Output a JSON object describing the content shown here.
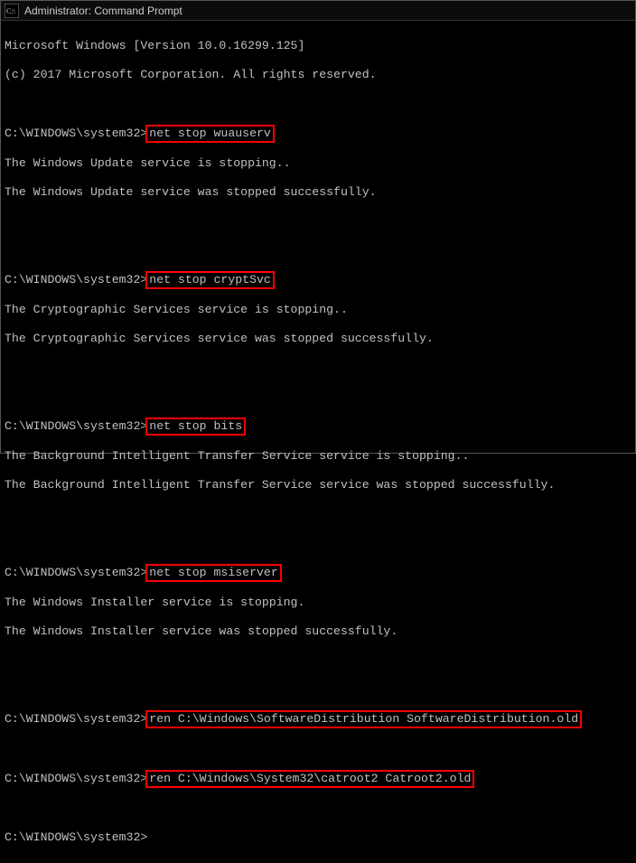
{
  "titlebar": {
    "title": "Administrator: Command Prompt"
  },
  "prompt": "C:\\WINDOWS\\system32>",
  "header": {
    "version": "Microsoft Windows [Version 10.0.16299.125]",
    "copyright": "(c) 2017 Microsoft Corporation. All rights reserved."
  },
  "blocks": [
    {
      "cmd": "net stop wuauserv",
      "out": [
        "The Windows Update service is stopping..",
        "The Windows Update service was stopped successfully."
      ]
    },
    {
      "cmd": "net stop cryptSvc",
      "out": [
        "The Cryptographic Services service is stopping..",
        "The Cryptographic Services service was stopped successfully."
      ]
    },
    {
      "cmd": "net stop bits",
      "out": [
        "The Background Intelligent Transfer Service service is stopping..",
        "The Background Intelligent Transfer Service service was stopped successfully."
      ]
    },
    {
      "cmd": "net stop msiserver",
      "out": [
        "The Windows Installer service is stopping.",
        "The Windows Installer service was stopped successfully."
      ]
    },
    {
      "cmd": "ren C:\\Windows\\SoftwareDistribution SoftwareDistribution.old",
      "out": []
    },
    {
      "cmd": "ren C:\\Windows\\System32\\catroot2 Catroot2.old",
      "out": []
    }
  ]
}
